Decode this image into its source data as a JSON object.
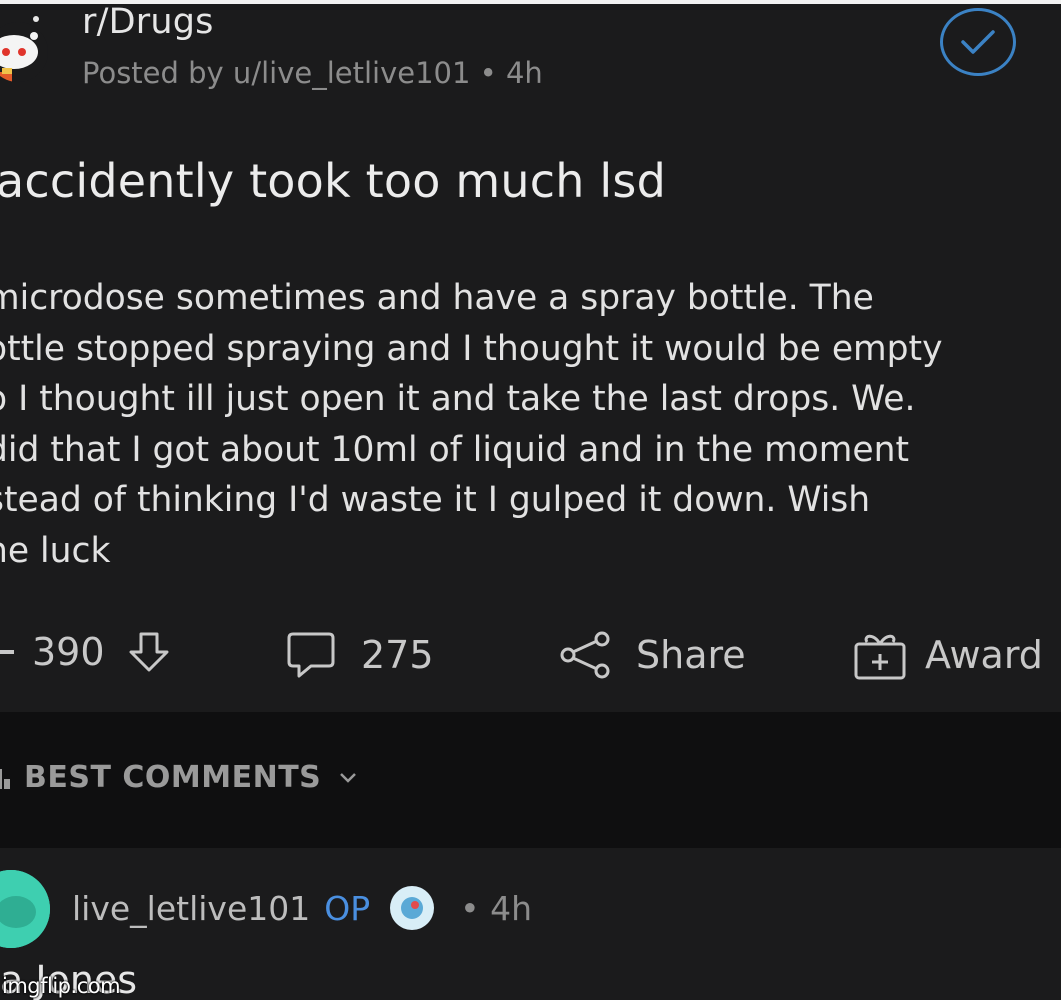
{
  "header": {
    "subreddit": "r/Drugs",
    "meta": "Posted by u/live_letlive101 • 4h"
  },
  "post": {
    "title": "accidently took too much lsd",
    "body_lines": [
      "microdose sometimes and have a spray bottle. The",
      "ottle stopped spraying and I thought it would be empty",
      "o I thought ill just open it and take the last drops. We.",
      "did that I got about 10ml of liquid and in the moment",
      "stead of thinking I'd waste it I gulped it down. Wish",
      "ne luck"
    ]
  },
  "actions": {
    "vote_count": "390",
    "comment_count": "275",
    "share_label": "Share",
    "award_label": "Award"
  },
  "comments_section": {
    "sort_label": "BEST COMMENTS"
  },
  "comment": {
    "username": "live_letlive101",
    "op_label": "OP",
    "time": "• 4h",
    "text": "a Jones"
  },
  "watermark": "imgflip.com",
  "colors": {
    "background": "#1b1b1c",
    "accent_blue": "#3b82c4",
    "avatar_teal": "#3ecfb0"
  }
}
